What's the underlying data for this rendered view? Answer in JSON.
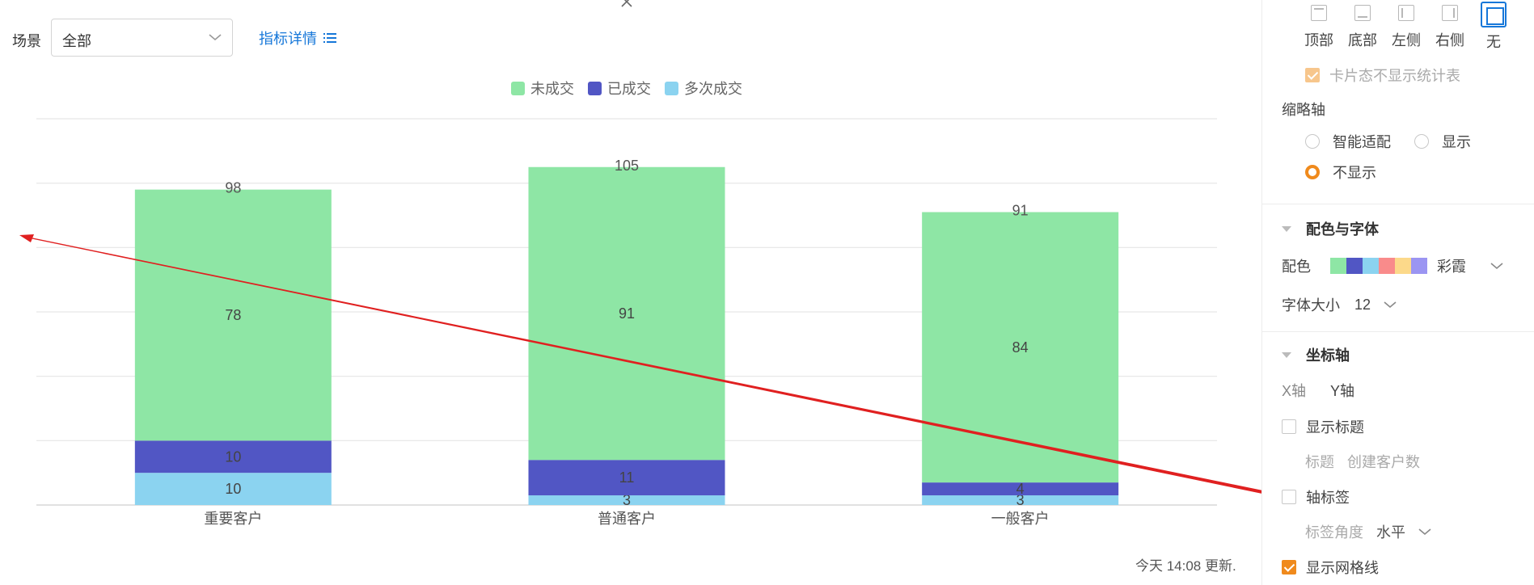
{
  "toolbar": {
    "scene_label": "场景",
    "scene_value": "全部",
    "metric_link": "指标详情"
  },
  "status": {
    "update_time": "今天 14:08 更新."
  },
  "chart_data": {
    "type": "bar",
    "stacked": true,
    "categories": [
      "重要客户",
      "普通客户",
      "一般客户"
    ],
    "series": [
      {
        "name": "多次成交",
        "color": "#8bd3f0",
        "values": [
          10,
          3,
          3
        ]
      },
      {
        "name": "已成交",
        "color": "#5156c4",
        "values": [
          10,
          11,
          4
        ]
      },
      {
        "name": "未成交",
        "color": "#8ee6a5",
        "values": [
          78,
          91,
          84
        ]
      }
    ],
    "legend_order": [
      "未成交",
      "已成交",
      "多次成交"
    ],
    "stack_totals": [
      98,
      105,
      91
    ],
    "ylim": [
      0,
      120
    ],
    "grid": true,
    "legend_position": "top"
  },
  "panel": {
    "positions": [
      {
        "label": "顶部",
        "icon": "legend-top-icon"
      },
      {
        "label": "底部",
        "icon": "legend-bottom-icon"
      },
      {
        "label": "左侧",
        "icon": "legend-left-icon"
      },
      {
        "label": "右侧",
        "icon": "legend-right-icon"
      },
      {
        "label": "无",
        "icon": "legend-none-icon"
      }
    ],
    "card_hide_stats": "卡片态不显示统计表",
    "thumb_axis_title": "缩略轴",
    "thumb_smart": "智能适配",
    "thumb_show": "显示",
    "thumb_hide": "不显示",
    "color_section": "配色与字体",
    "color_label": "配色",
    "palette_name": "彩霞",
    "palette": [
      "#8ee6a5",
      "#5156c4",
      "#8bd3f0",
      "#f98b8b",
      "#fcd98a",
      "#9b95f2"
    ],
    "font_size_label": "字体大小",
    "font_size_value": "12",
    "axis_section": "坐标轴",
    "x_axis": "X轴",
    "y_axis": "Y轴",
    "show_title": "显示标题",
    "title_label": "标题",
    "title_placeholder": "创建客户数",
    "axis_tick_label": "轴标签",
    "tick_angle_label": "标签角度",
    "tick_angle_value": "水平",
    "show_grid": "显示网格线"
  }
}
